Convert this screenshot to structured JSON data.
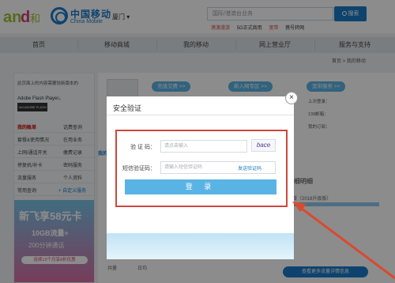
{
  "header": {
    "logo_text": "and和",
    "brand_cn": "中国移动",
    "brand_en": "China Mobile",
    "city": "厦门 ▾",
    "search_placeholder": "国际/港澳台业务",
    "search_button": "搜索",
    "hot_links": [
      "港澳漫游",
      "5G正式商用",
      "宽带",
      "携号转网"
    ]
  },
  "nav": {
    "items": [
      "首页",
      "移动商城",
      "我的移动",
      "网上营业厅",
      "服务与支持"
    ]
  },
  "breadcrumb": "首页 > 我的移动",
  "left": {
    "notice": "此页面上的内容需要较新版本的",
    "flash_label": "Adobe Flash Player。",
    "flash_badge": "Get ADOBE FLASH PLAYER",
    "rows": [
      [
        "我的账单",
        "话费查询"
      ],
      [
        "套餐&使用情况",
        "在用业务"
      ],
      [
        "上网/通话开关",
        "缴费记录"
      ],
      [
        "停复机/补卡",
        "密码服务"
      ],
      [
        "流量服务",
        "个人资料"
      ],
      [
        "常用查询",
        "+ 自定义服务"
      ]
    ],
    "promo_title": "新飞享58元卡",
    "promo_line2": "10GB流量+",
    "promo_line3": "200分钟通话",
    "promo_bar": "连续13个月享8折优惠"
  },
  "main": {
    "pills": [
      "充值交费 >>",
      "新入网专区 >>",
      "宽带服务 >>"
    ],
    "info": [
      "上次登录：",
      "139邮箱：",
      "我的订阅："
    ],
    "section_label": "我的",
    "detail_title": "细明细",
    "plan_text": "套餐（2018升级版）",
    "detail_button": "查看更多流量详情信息",
    "cell_1": "共量",
    "cell_2": "日均"
  },
  "modal": {
    "title": "安全验证",
    "close": "×",
    "captcha_label": "验 证 码：",
    "captcha_placeholder": "请点击输入",
    "captcha_image_text": "bace",
    "sms_label": "短信验证码：",
    "sms_placeholder": "请输入短信验证码",
    "send_code": "发送验证码",
    "login_button": "登 录"
  },
  "colors": {
    "accent_blue": "#1a7bc9",
    "button_blue": "#5ab3e5",
    "highlight_red": "#d0473b"
  }
}
